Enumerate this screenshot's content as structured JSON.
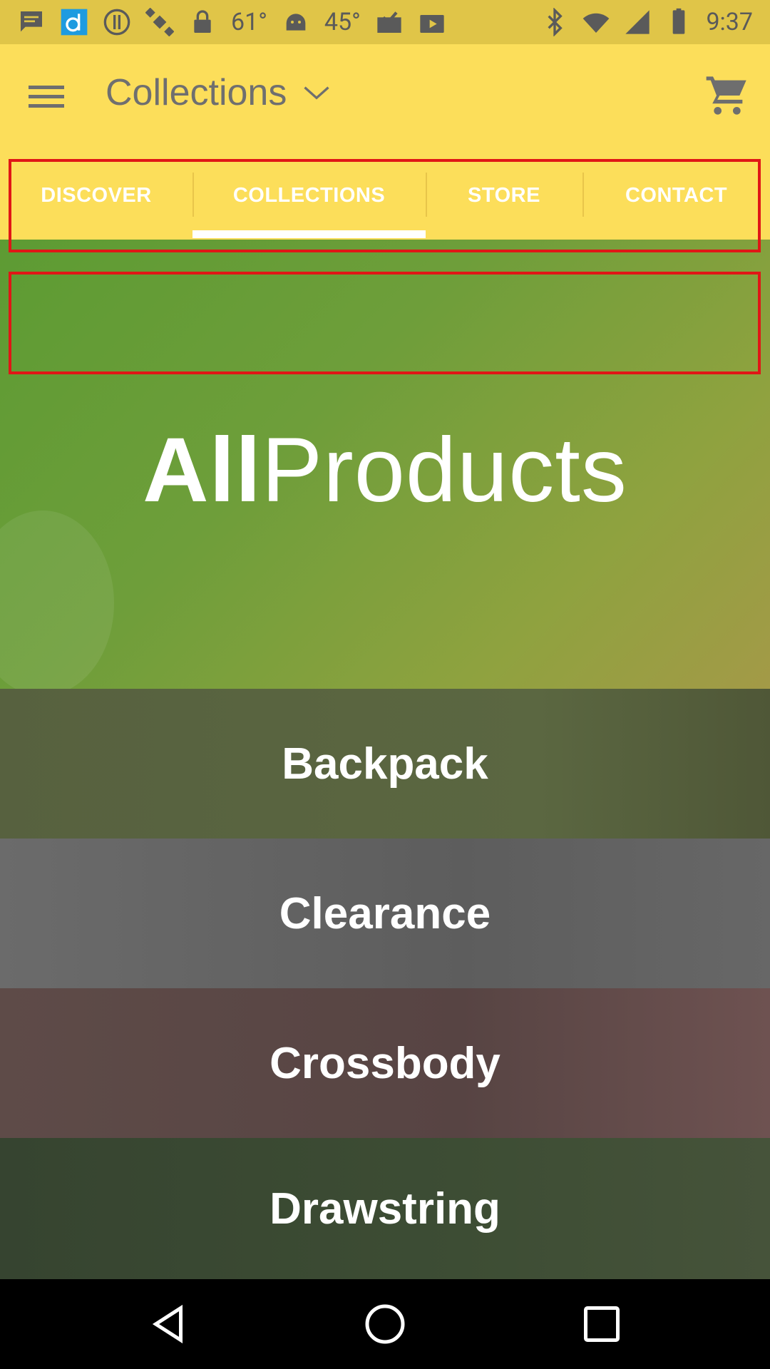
{
  "status_bar": {
    "temperature1": "61°",
    "temperature2": "45°",
    "time": "9:37"
  },
  "app_bar": {
    "title": "Collections"
  },
  "tabs": [
    {
      "label": "DISCOVER"
    },
    {
      "label": "COLLECTIONS",
      "active": true
    },
    {
      "label": "STORE"
    },
    {
      "label": "CONTACT"
    }
  ],
  "hero": {
    "title_bold": "All",
    "title_light": "Products"
  },
  "categories": [
    {
      "label": "Backpack"
    },
    {
      "label": "Clearance"
    },
    {
      "label": "Crossbody"
    },
    {
      "label": "Drawstring"
    }
  ],
  "colors": {
    "app_bar": "#fcde5a",
    "highlight": "#e01616"
  }
}
